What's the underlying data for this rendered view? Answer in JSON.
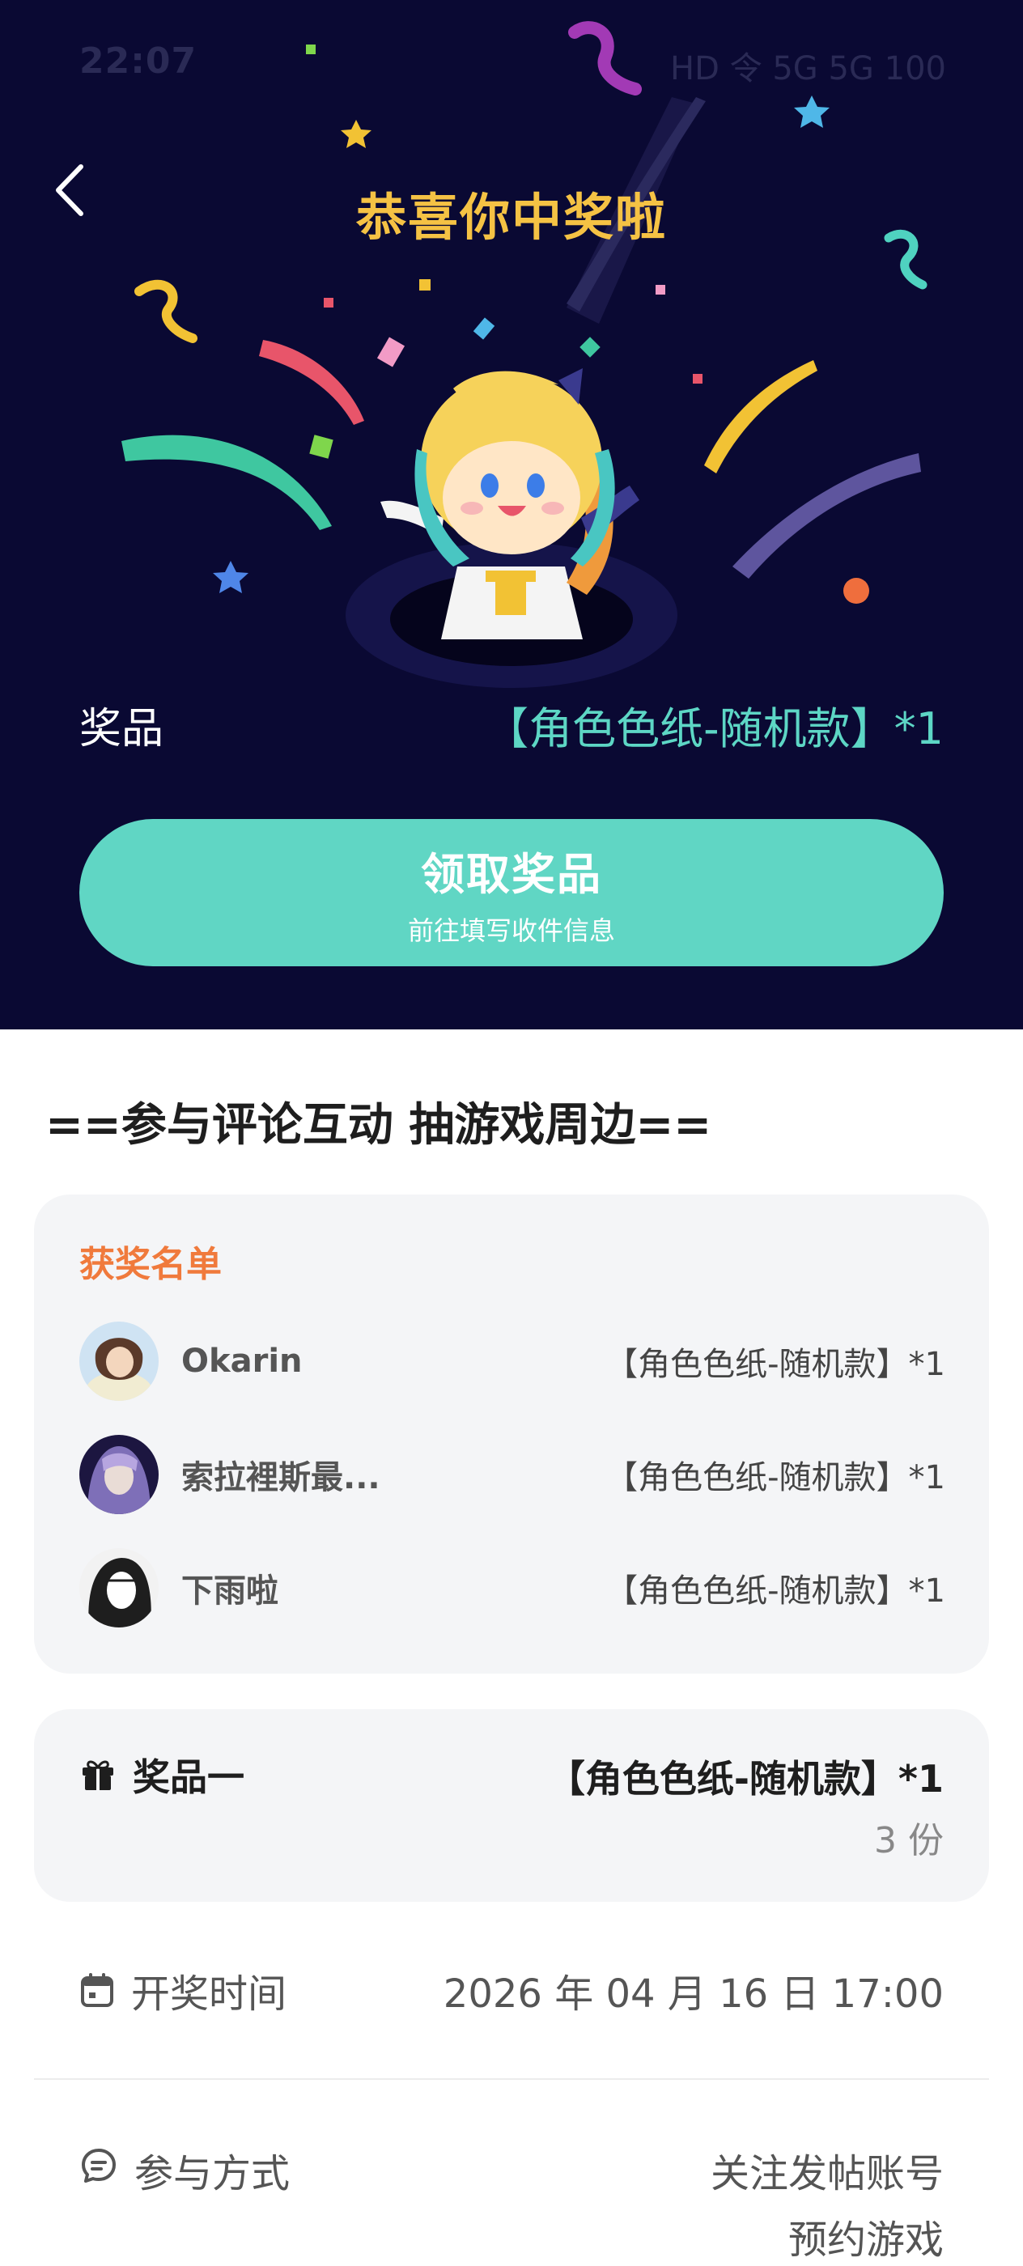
{
  "status_bar": {
    "time": "22:07",
    "icons": "HD 令 5G 5G 100"
  },
  "header": {
    "title": "恭喜你中奖啦"
  },
  "prize": {
    "label": "奖品",
    "value": "【角色色纸-随机款】*1"
  },
  "claim_button": {
    "label": "领取奖品",
    "sublabel": "前往填写收件信息"
  },
  "post": {
    "title": "==参与评论互动 抽游戏周边=="
  },
  "winners": {
    "title": "获奖名单",
    "items": [
      {
        "name": "Okarin",
        "prize": "【角色色纸-随机款】*1"
      },
      {
        "name": "索拉裡斯最...",
        "prize": "【角色色纸-随机款】*1"
      },
      {
        "name": "下雨啦",
        "prize": "【角色色纸-随机款】*1"
      }
    ]
  },
  "prize_card": {
    "label": "奖品一",
    "value": "【角色色纸-随机款】*1",
    "count": "3 份"
  },
  "draw_time": {
    "label": "开奖时间",
    "value": "2026 年 04 月 16 日 17:00"
  },
  "participation": {
    "label": "参与方式",
    "line1": "关注发帖账号",
    "line2": "预约游戏"
  },
  "colors": {
    "banner_bg": "#0a0933",
    "title": "#f5c244",
    "accent": "#60d6c4",
    "winners_title": "#f07a3c"
  }
}
